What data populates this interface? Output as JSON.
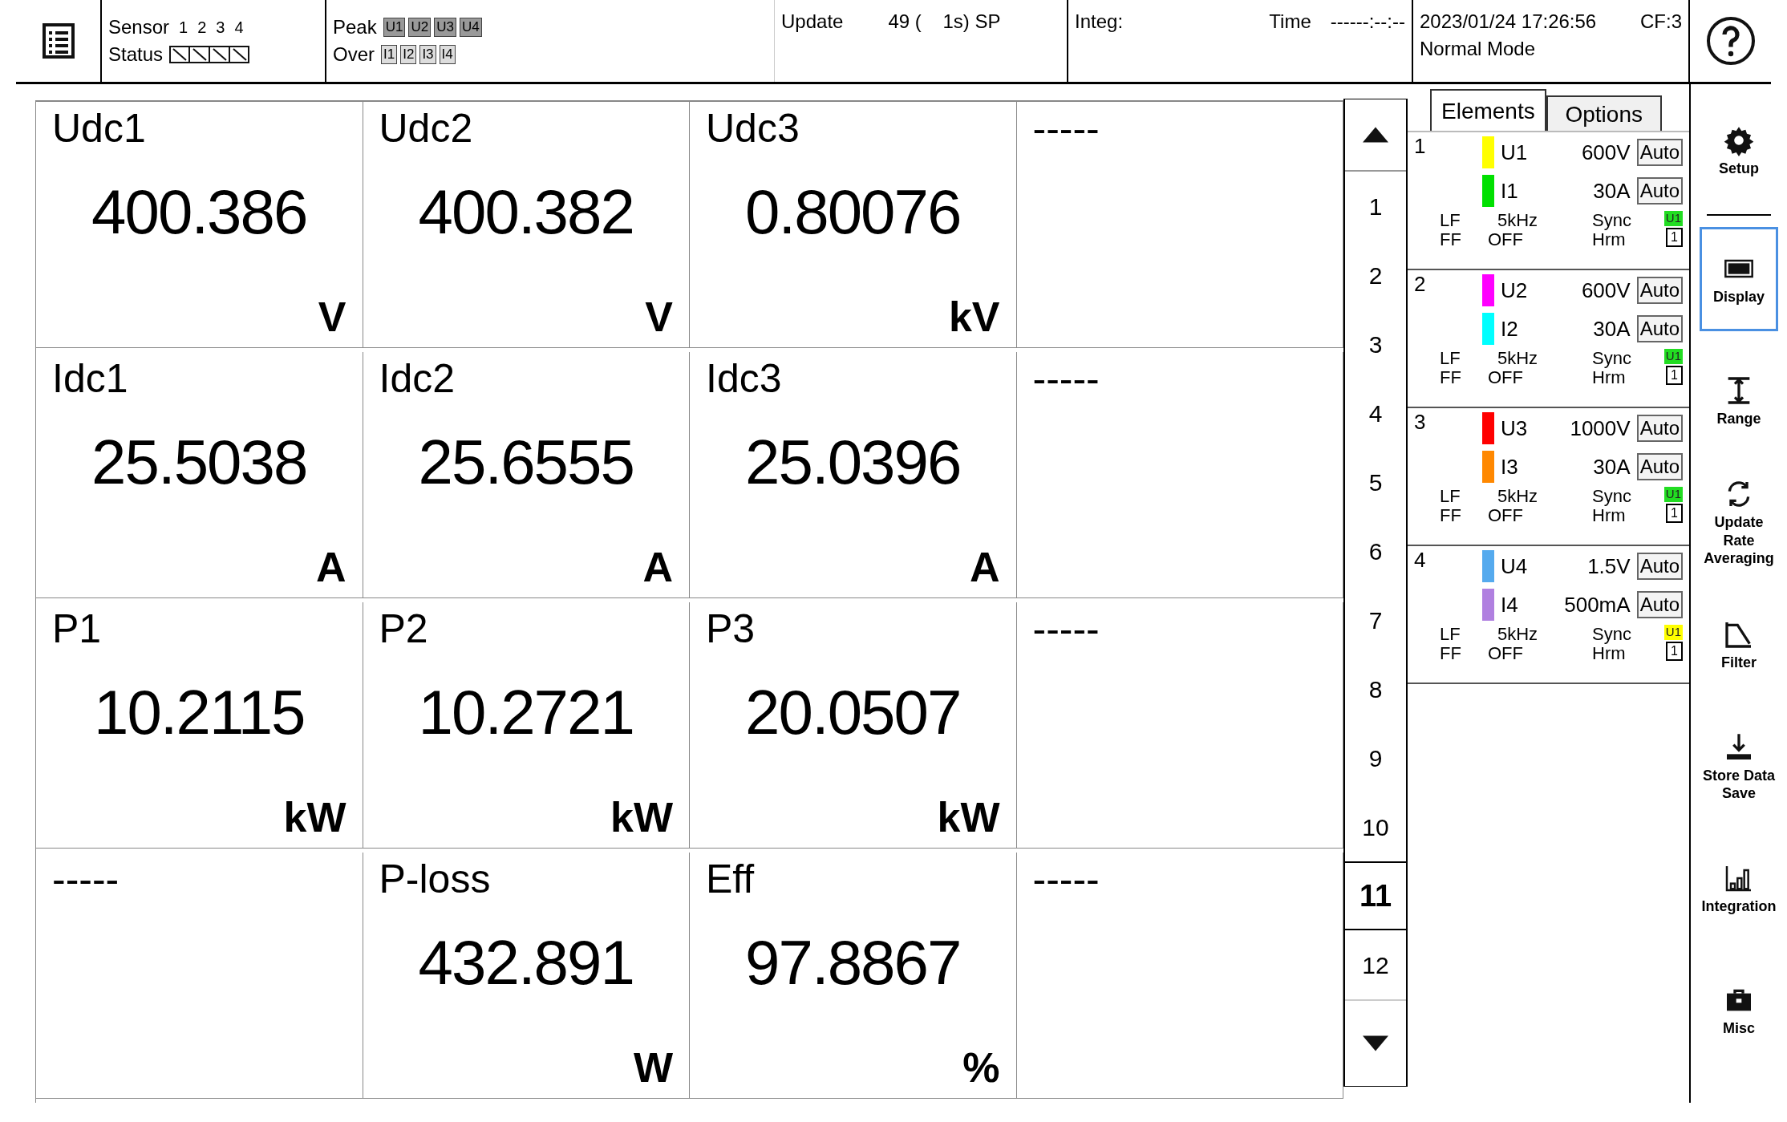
{
  "header": {
    "sensor_label": "Sensor",
    "sensor_numbers": [
      "1",
      "2",
      "3",
      "4"
    ],
    "status_label": "Status",
    "peak_label": "Peak",
    "peak_items": [
      "U1",
      "U2",
      "U3",
      "U4"
    ],
    "over_label": "Over",
    "over_items": [
      "I1",
      "I2",
      "I3",
      "I4"
    ],
    "update_label": "Update",
    "update_value": "49 (    1s) SP",
    "integ_label": "Integ:",
    "time_label": "Time",
    "time_value": "------:--:--",
    "datetime": "2023/01/24 17:26:56",
    "cf": "CF:3",
    "mode": "Normal Mode"
  },
  "cells": [
    {
      "label": "Udc1",
      "value": "400.386",
      "unit": "V"
    },
    {
      "label": "Udc2",
      "value": "400.382",
      "unit": "V"
    },
    {
      "label": "Udc3",
      "value": "0.80076",
      "unit": "kV"
    },
    {
      "label": "-----"
    },
    {
      "label": "Idc1",
      "value": "25.5038",
      "unit": "A"
    },
    {
      "label": "Idc2",
      "value": "25.6555",
      "unit": "A"
    },
    {
      "label": "Idc3",
      "value": "25.0396",
      "unit": "A"
    },
    {
      "label": "-----"
    },
    {
      "label": "P1",
      "value": "10.2115",
      "unit": "kW"
    },
    {
      "label": "P2",
      "value": "10.2721",
      "unit": "kW"
    },
    {
      "label": "P3",
      "value": "20.0507",
      "unit": "kW"
    },
    {
      "label": "-----"
    },
    {
      "label": "-----"
    },
    {
      "label": "P-loss",
      "value": "432.891",
      "unit": "W"
    },
    {
      "label": "Eff",
      "value": "97.8867",
      "unit": "%"
    },
    {
      "label": "-----"
    }
  ],
  "pages": [
    {
      "label": "1",
      "selected": false
    },
    {
      "label": "2",
      "selected": false
    },
    {
      "label": "3",
      "selected": false
    },
    {
      "label": "4",
      "selected": false
    },
    {
      "label": "5",
      "selected": false
    },
    {
      "label": "6",
      "selected": false
    },
    {
      "label": "7",
      "selected": false
    },
    {
      "label": "8",
      "selected": false
    },
    {
      "label": "9",
      "selected": false
    },
    {
      "label": "10",
      "selected": false
    },
    {
      "label": "11",
      "selected": true
    },
    {
      "label": "12",
      "selected": false
    }
  ],
  "panel_tabs": [
    {
      "label": "Elements",
      "selected": true
    },
    {
      "label": "Options",
      "selected": false
    }
  ],
  "elements": [
    {
      "number": "1",
      "channels": [
        {
          "name": "U1",
          "color": "#ffff00",
          "range": "600V",
          "mode": "Auto"
        },
        {
          "name": "I1",
          "color": "#00e000",
          "range": "30A",
          "mode": "Auto"
        }
      ],
      "lf_label": "LF",
      "lf_value": "5kHz",
      "ff_label": "FF",
      "ff_value": "OFF",
      "sync_label": "Sync",
      "sync": {
        "label": "U1",
        "color": "#22dd22"
      },
      "hrm_label": "Hrm",
      "hrm_value": "1"
    },
    {
      "number": "2",
      "channels": [
        {
          "name": "U2",
          "color": "#ff00ff",
          "range": "600V",
          "mode": "Auto"
        },
        {
          "name": "I2",
          "color": "#00ffff",
          "range": "30A",
          "mode": "Auto"
        }
      ],
      "lf_label": "LF",
      "lf_value": "5kHz",
      "ff_label": "FF",
      "ff_value": "OFF",
      "sync_label": "Sync",
      "sync": {
        "label": "U1",
        "color": "#22dd22"
      },
      "hrm_label": "Hrm",
      "hrm_value": "1"
    },
    {
      "number": "3",
      "channels": [
        {
          "name": "U3",
          "color": "#ff0000",
          "range": "1000V",
          "mode": "Auto"
        },
        {
          "name": "I3",
          "color": "#ff8800",
          "range": "30A",
          "mode": "Auto"
        }
      ],
      "lf_label": "LF",
      "lf_value": "5kHz",
      "ff_label": "FF",
      "ff_value": "OFF",
      "sync_label": "Sync",
      "sync": {
        "label": "U1",
        "color": "#22dd22"
      },
      "hrm_label": "Hrm",
      "hrm_value": "1"
    },
    {
      "number": "4",
      "channels": [
        {
          "name": "U4",
          "color": "#55aaee",
          "range": "1.5V",
          "mode": "Auto"
        },
        {
          "name": "I4",
          "color": "#b080e0",
          "range": "500mA",
          "mode": "Auto"
        }
      ],
      "lf_label": "LF",
      "lf_value": "5kHz",
      "ff_label": "FF",
      "ff_value": "OFF",
      "sync_label": "Sync",
      "sync": {
        "label": "U1",
        "color": "#ffff00"
      },
      "hrm_label": "Hrm",
      "hrm_value": "1"
    }
  ],
  "side_buttons": [
    {
      "kind": "setup",
      "label": "Setup",
      "selected": false
    },
    {
      "kind": "display",
      "label": "Display",
      "selected": true
    },
    {
      "kind": "range",
      "label": "Range",
      "selected": false
    },
    {
      "kind": "update",
      "label": "Update Rate Averaging",
      "selected": false
    },
    {
      "kind": "filter",
      "label": "Filter",
      "selected": false
    },
    {
      "kind": "store",
      "label": "Store Data Save",
      "selected": false
    },
    {
      "kind": "integration",
      "label": "Integration",
      "selected": false
    },
    {
      "kind": "misc",
      "label": "Misc",
      "selected": false
    }
  ]
}
